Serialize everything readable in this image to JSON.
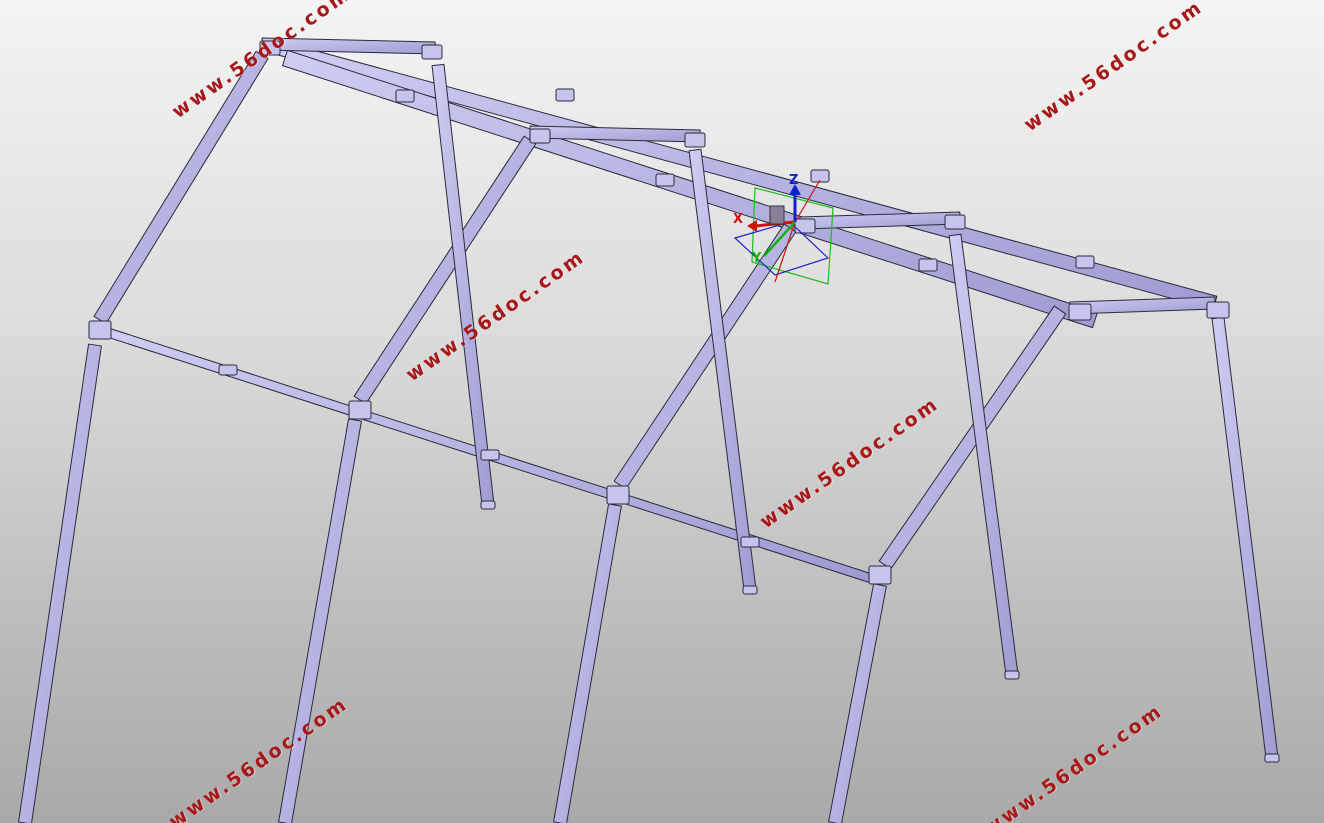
{
  "viewport": {
    "name": "3D model view",
    "background": [
      "#f4f4f4",
      "#bdbdbd"
    ],
    "part_color": "#b7b4e6",
    "edge_color": "#2a2a3a"
  },
  "compass": {
    "x_label": "X",
    "y_label": "Y",
    "z_label": "Z",
    "x_color": "#d01010",
    "y_color": "#10b010",
    "z_color": "#1020d0"
  },
  "watermarks": [
    {
      "text": "www.56doc.com"
    },
    {
      "text": "www.56doc.com"
    },
    {
      "text": "www.56doc.com"
    },
    {
      "text": "www.56doc.com"
    },
    {
      "text": "www.56doc.com"
    },
    {
      "text": "www.56doc.com"
    }
  ]
}
